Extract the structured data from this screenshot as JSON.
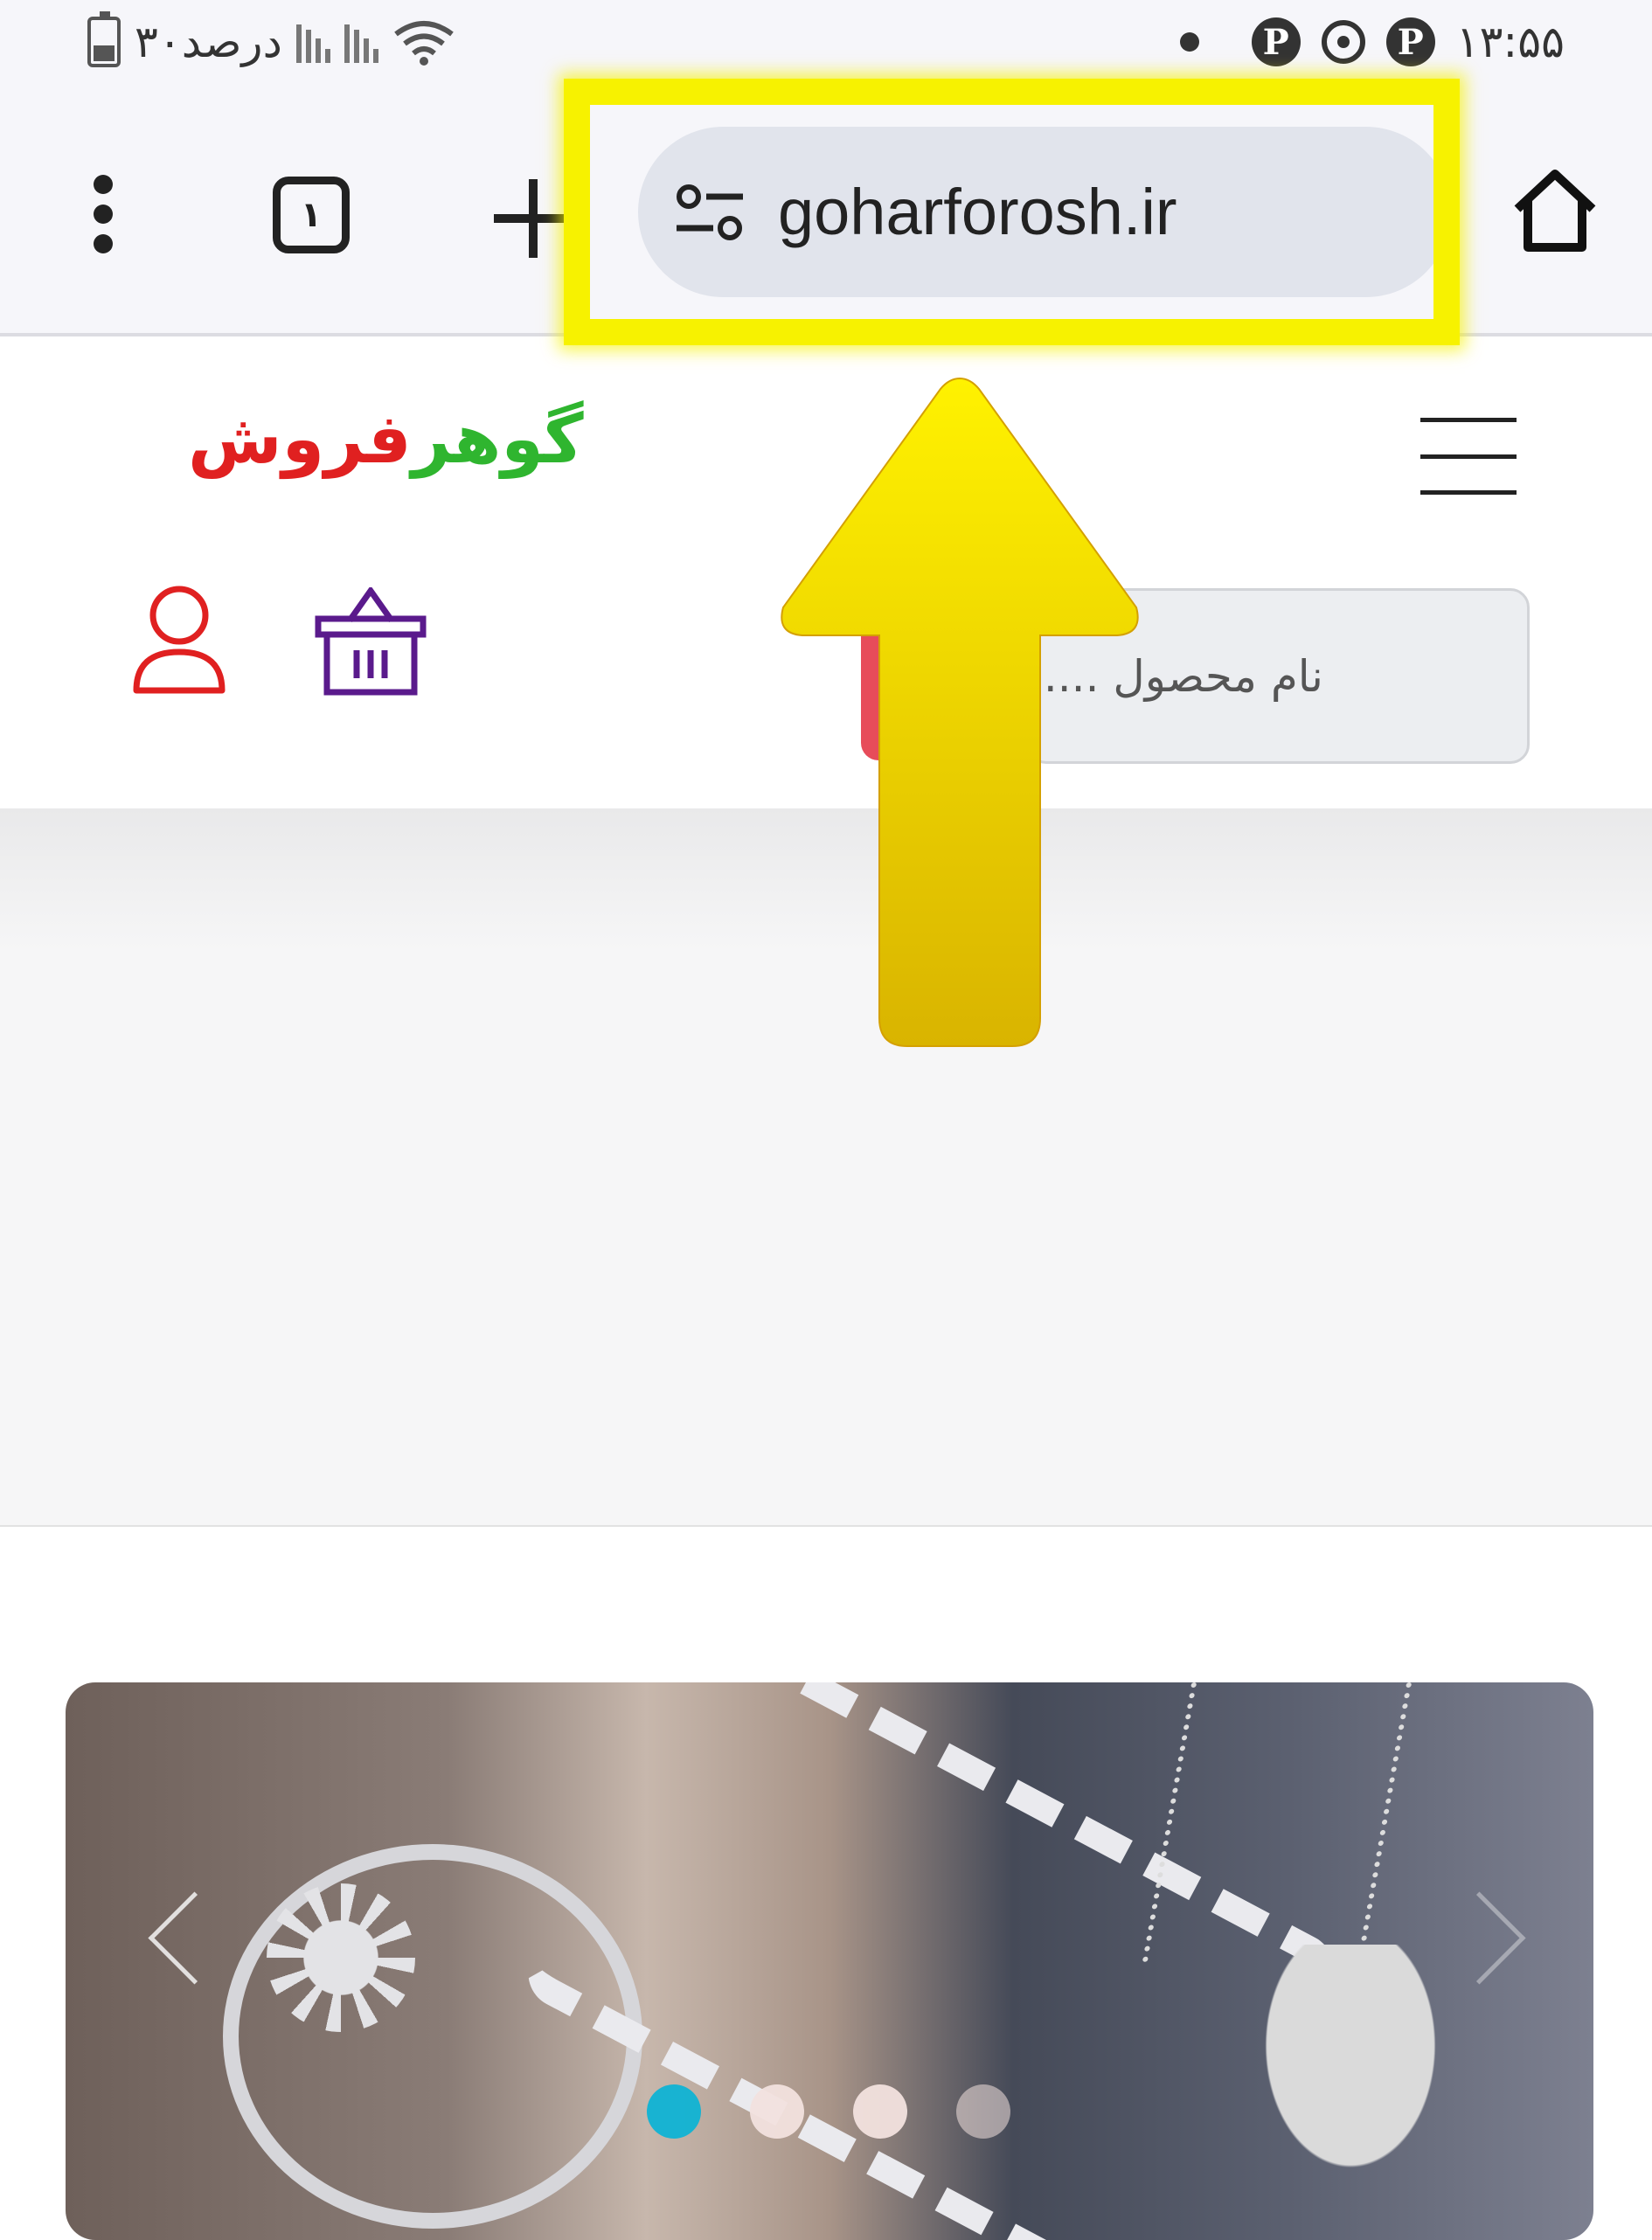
{
  "status_bar": {
    "battery_text": "۳۰درصد",
    "time": "۱۳:۵۵"
  },
  "browser": {
    "url": "goharforosh.ir",
    "tab_count": "۱",
    "icons": [
      "more-vert-icon",
      "tabs-icon",
      "plus-icon",
      "page-info-icon",
      "home-icon"
    ]
  },
  "site": {
    "logo_part1": "گوهر",
    "logo_part2": "فروش",
    "search_placeholder": "نام محصول .....",
    "icons": [
      "hamburger-menu-icon",
      "user-icon",
      "basket-icon"
    ],
    "slider": {
      "dot_count": 4,
      "active_dot": 1
    }
  },
  "colors": {
    "accent": "#0fb3d4",
    "search_button": "#e74c5a",
    "logo_green": "#2fb52f",
    "logo_red": "#e02020",
    "basket": "#5a1a8c",
    "user_icon": "#e02020",
    "annotation_yellow": "#f7f200"
  }
}
